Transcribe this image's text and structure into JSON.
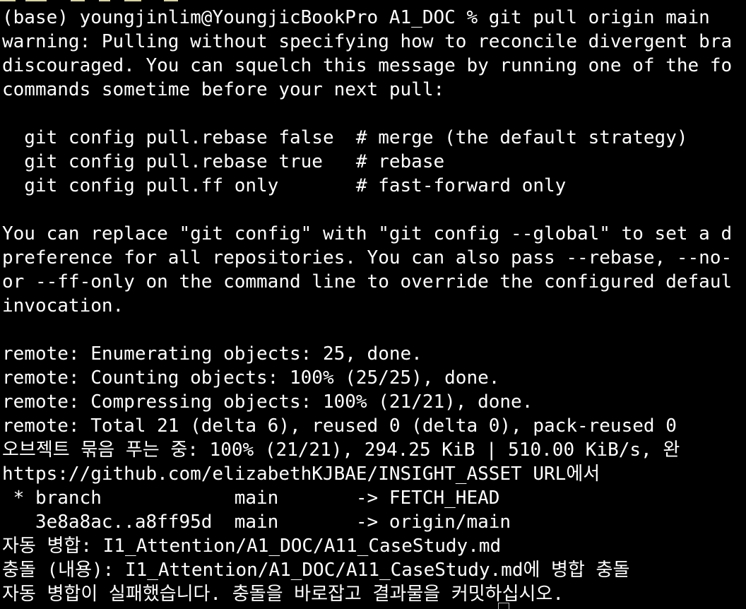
{
  "terminal": {
    "background": "#000000",
    "text_color": "#ffffff",
    "lines": [
      "(base) youngjinlim@YoungjicBookPro A1_DOC % git pull origin main",
      "warning: Pulling without specifying how to reconcile divergent bra",
      "discouraged. You can squelch this message by running one of the fo",
      "commands sometime before your next pull:",
      "",
      "  git config pull.rebase false  # merge (the default strategy)",
      "  git config pull.rebase true   # rebase",
      "  git config pull.ff only       # fast-forward only",
      "",
      "You can replace \"git config\" with \"git config --global\" to set a d",
      "preference for all repositories. You can also pass --rebase, --no-",
      "or --ff-only on the command line to override the configured defaul",
      "invocation.",
      "",
      "remote: Enumerating objects: 25, done.",
      "remote: Counting objects: 100% (25/25), done.",
      "remote: Compressing objects: 100% (21/21), done.",
      "remote: Total 21 (delta 6), reused 0 (delta 0), pack-reused 0",
      "오브젝트 묶음 푸는 중: 100% (21/21), 294.25 KiB | 510.00 KiB/s, 완",
      "https://github.com/elizabethKJBAE/INSIGHT_ASSET URL에서",
      " * branch            main       -> FETCH_HEAD",
      "   3e8a8ac..a8ff95d  main       -> origin/main",
      "자동 병합: I1_Attention/A1_DOC/A11_CaseStudy.md",
      "충돌 (내용): I1_Attention/A1_DOC/A11_CaseStudy.md에 병합 충돌",
      "자동 병합이 실패했습니다. 충돌을 바로잡고 결과물을 커밋하십시오."
    ]
  }
}
